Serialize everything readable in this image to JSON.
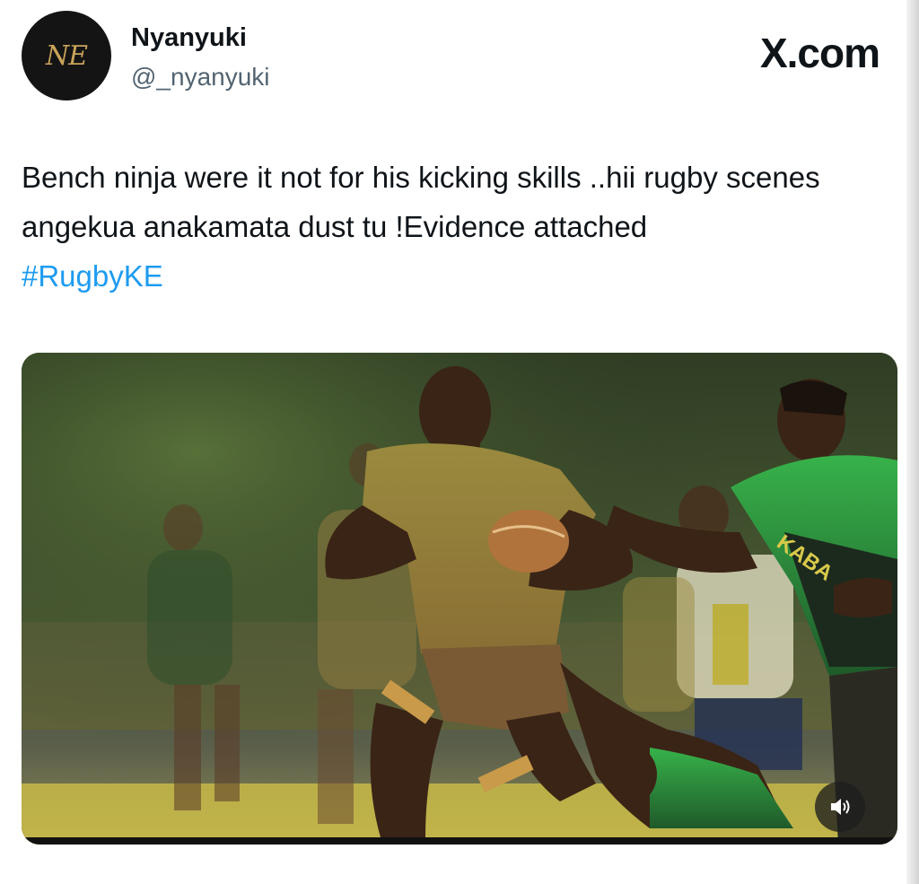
{
  "author": {
    "display_name": "Nyanyuki",
    "handle": "@_nyanyuki",
    "avatar_monogram": "NE"
  },
  "brand": "X.com",
  "tweet": {
    "text": "Bench ninja were it not for his kicking skills ..hii rugby scenes angekua anakamata dust tu !Evidence attached",
    "hashtag": "#RugbyKE"
  },
  "media": {
    "jersey_text": "KABA",
    "volume_icon": "speaker-icon"
  },
  "colors": {
    "link": "#1d9bf0",
    "handle": "#536471",
    "text": "#0f1419",
    "avatar_gold": "#c9a35a"
  }
}
